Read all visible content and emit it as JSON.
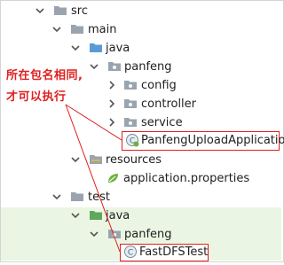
{
  "tree": {
    "src": "src",
    "main": "main",
    "main_java": "java",
    "main_package": "panfeng",
    "config": "config",
    "controller": "controller",
    "service": "service",
    "app_class": "PanfengUploadApplication",
    "resources": "resources",
    "app_properties": "application.properties",
    "test": "test",
    "test_java": "java",
    "test_package": "panfeng",
    "test_class": "FastDFSTest"
  },
  "annotation": {
    "line1": "所在包名相同,",
    "line2": "才可以执行"
  },
  "colors": {
    "highlight_row": "#eaf6e3",
    "annotation": "#e02020",
    "folder": "#9aa4ae",
    "source_folder": "#5b9bd5",
    "test_folder": "#5fa85a"
  },
  "icons": {
    "folder": "folder-icon",
    "package": "package-icon",
    "class": "spring-class-icon",
    "properties": "spring-leaf-icon"
  }
}
